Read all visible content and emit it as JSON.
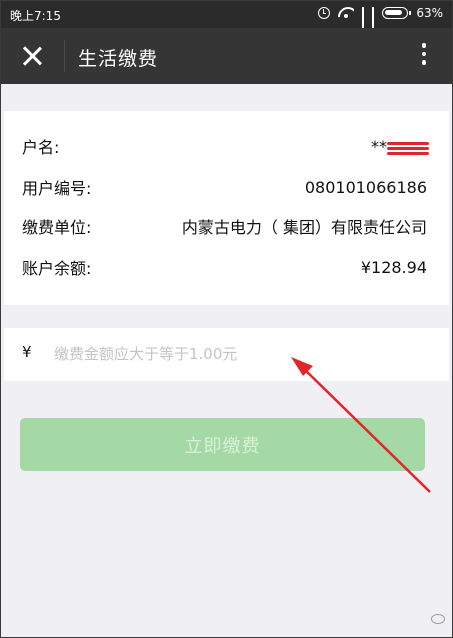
{
  "status_bar": {
    "time": "晚上7:15",
    "battery": "63%"
  },
  "header": {
    "title": "生活缴费"
  },
  "account": {
    "rows": [
      {
        "label": "户名:",
        "value": "**"
      },
      {
        "label": "用户编号:",
        "value": "080101066186"
      },
      {
        "label": "缴费单位:",
        "value": "内蒙古电力（ 集团）有限责任公司"
      },
      {
        "label": "账户余额:",
        "value": "¥128.94"
      }
    ]
  },
  "payment": {
    "currency": "¥",
    "placeholder": "缴费金额应大于等于1.00元",
    "value": "",
    "button_label": "立即缴费"
  },
  "colors": {
    "status_bar_bg": "#2b2b2b",
    "title_bar_bg": "#353535",
    "page_bg": "#efeff4",
    "button_disabled": "#a4d9a5",
    "annotation_arrow": "#e2242b"
  },
  "icons": {
    "close": "close-icon",
    "more": "more-vertical-icon"
  }
}
